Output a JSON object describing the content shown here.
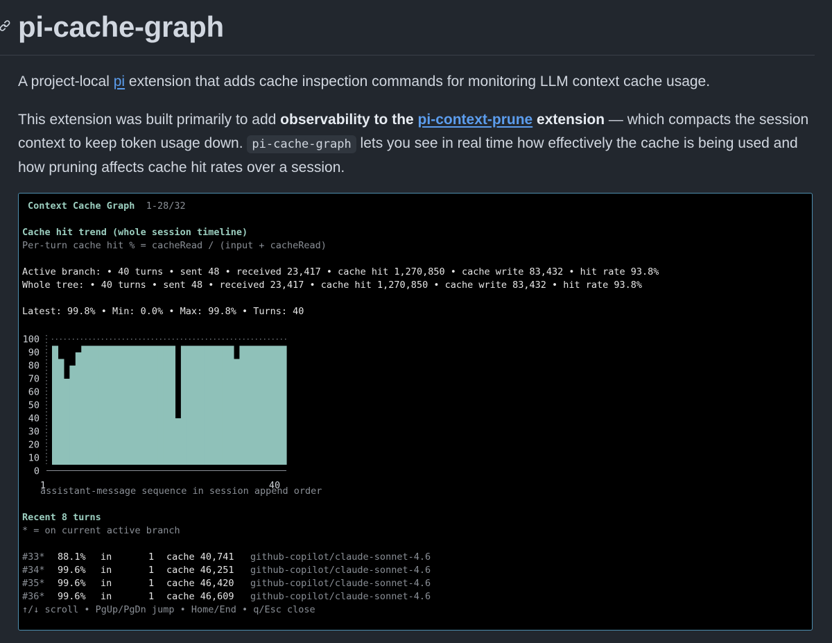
{
  "page": {
    "title": "pi-cache-graph",
    "intro": {
      "before": "A project-local ",
      "link": "pi",
      "after": " extension that adds cache inspection commands for monitoring LLM context cache usage."
    },
    "para2": {
      "t1": "This extension was built primarily to add ",
      "bold1": "observability to the ",
      "link": "pi-context-prune",
      "bold2": " extension",
      "t2": " — which compacts the session context to keep token usage down. ",
      "code": "pi-cache-graph",
      "t3": " lets you see in real time how effectively the cache is being used and how pruning affects cache hit rates over a session."
    }
  },
  "terminal": {
    "header_title": "Context Cache Graph",
    "header_range": "1-28/32",
    "section_title": "Cache hit trend (whole session timeline)",
    "formula": "Per-turn cache hit % = cacheRead / (input + cacheRead)",
    "active_branch": "Active branch: • 40 turns • sent 48 • received 23,417 • cache hit 1,270,850 • cache write 83,432 • hit rate 93.8%",
    "whole_tree": "Whole tree: • 40 turns • sent 48 • received 23,417 • cache hit 1,270,850 • cache write 83,432 • hit rate 93.8%",
    "summary": "Latest: 99.8% • Min: 0.0% • Max: 99.8% • Turns: 40",
    "x_axis_label": "assistant-message sequence in session append order",
    "recent_title": "Recent 8 turns",
    "recent_note": "* = on current active branch",
    "recent_rows": [
      {
        "id": "#33*",
        "pct": "88.1%",
        "dir": "in",
        "count": "1",
        "cache": "cache 40,741",
        "model": "github-copilot/claude-sonnet-4.6"
      },
      {
        "id": "#34*",
        "pct": "99.6%",
        "dir": "in",
        "count": "1",
        "cache": "cache 46,251",
        "model": "github-copilot/claude-sonnet-4.6"
      },
      {
        "id": "#35*",
        "pct": "99.6%",
        "dir": "in",
        "count": "1",
        "cache": "cache 46,420",
        "model": "github-copilot/claude-sonnet-4.6"
      },
      {
        "id": "#36*",
        "pct": "99.6%",
        "dir": "in",
        "count": "1",
        "cache": "cache 46,609",
        "model": "github-copilot/claude-sonnet-4.6"
      }
    ],
    "footer": "↑/↓ scroll • PgUp/PgDn jump • Home/End • q/Esc close"
  },
  "chart_data": {
    "type": "bar",
    "y_ticks": [
      "100",
      "90",
      "80",
      "70",
      "60",
      "50",
      "40",
      "30",
      "20",
      "10",
      "0"
    ],
    "x_ticks": [
      "1",
      "40"
    ],
    "ylim": [
      0,
      100
    ],
    "x": [
      1,
      2,
      3,
      4,
      5,
      6,
      7,
      8,
      9,
      10,
      11,
      12,
      13,
      14,
      15,
      16,
      17,
      18,
      19,
      20,
      21,
      22,
      23,
      24,
      25,
      26,
      27,
      28,
      29,
      30,
      31,
      32,
      33,
      34,
      35,
      36,
      37,
      38,
      39,
      40
    ],
    "values": [
      95,
      85,
      70,
      80,
      90,
      95,
      95,
      95,
      95,
      95,
      95,
      95,
      95,
      95,
      95,
      95,
      95,
      95,
      95,
      95,
      95,
      40,
      95,
      95,
      95,
      95,
      95,
      95,
      95,
      95,
      95,
      85,
      95,
      95,
      95,
      95,
      95,
      95,
      95,
      95
    ],
    "color": "#8fc1b9"
  },
  "colors": {
    "background": "#22272e",
    "link": "#5c9ded",
    "terminal_border": "#4f8fb0",
    "accent_teal": "#9ccfc0"
  }
}
